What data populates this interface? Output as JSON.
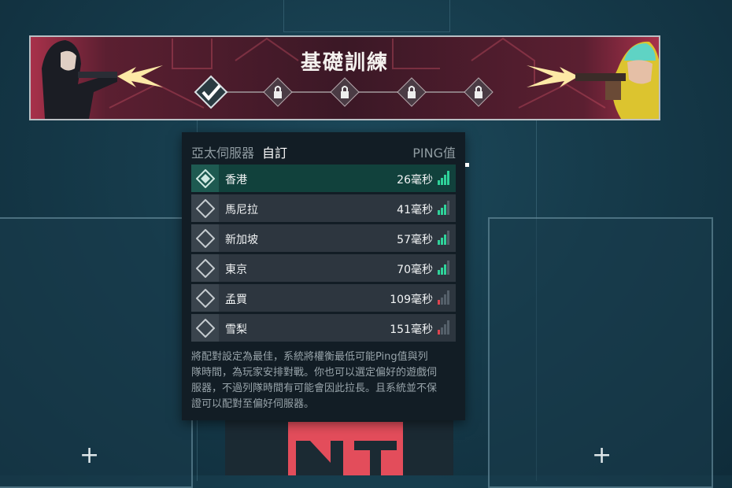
{
  "banner": {
    "title": "基礎訓練",
    "steps": [
      {
        "state": "completed",
        "icon": "check-icon"
      },
      {
        "state": "locked",
        "icon": "lock-icon"
      },
      {
        "state": "locked",
        "icon": "lock-icon"
      },
      {
        "state": "locked",
        "icon": "lock-icon"
      },
      {
        "state": "locked",
        "icon": "lock-icon"
      }
    ]
  },
  "server_panel": {
    "region": "亞太伺服器",
    "mode": "自訂",
    "ping_header": "PING值",
    "servers": [
      {
        "name": "香港",
        "ping": "26毫秒",
        "signal_bars": 4,
        "signal_color": "#2fd39a",
        "selected": true
      },
      {
        "name": "馬尼拉",
        "ping": "41毫秒",
        "signal_bars": 3,
        "signal_color": "#2fd39a",
        "selected": false
      },
      {
        "name": "新加坡",
        "ping": "57毫秒",
        "signal_bars": 3,
        "signal_color": "#2fd39a",
        "selected": false
      },
      {
        "name": "東京",
        "ping": "70毫秒",
        "signal_bars": 3,
        "signal_color": "#2fd39a",
        "selected": false
      },
      {
        "name": "孟買",
        "ping": "109毫秒",
        "signal_bars": 1,
        "signal_color": "#e0444f",
        "selected": false
      },
      {
        "name": "雪梨",
        "ping": "151毫秒",
        "signal_bars": 1,
        "signal_color": "#e0444f",
        "selected": false
      }
    ],
    "note_lines": [
      "將配對設定為最佳，系統將權衡最低可能Ping值與列",
      "隊時間，為玩家安排對戰。你也可以選定偏好的遊戲伺",
      "服器，不過列隊時間有可能會因此拉長。且系統並不保",
      "證可以配對至偏好伺服器。"
    ]
  },
  "slots": {
    "left_plus": "+",
    "right_plus": "+"
  },
  "colors": {
    "accent_green": "#2fd39a",
    "accent_red": "#e0444f",
    "banner_red": "#a8314a"
  }
}
